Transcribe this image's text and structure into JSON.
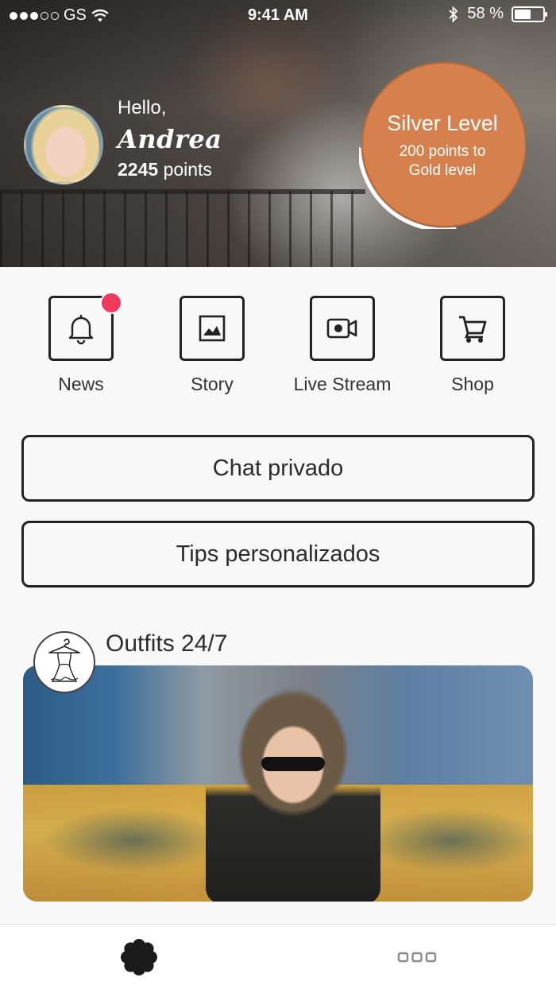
{
  "status_bar": {
    "carrier": "GS",
    "signal_dots_filled": 3,
    "signal_dots_total": 5,
    "time": "9:41 AM",
    "battery_percent": "58 %",
    "battery_level": 0.58,
    "icons": [
      "wifi-icon",
      "bluetooth-icon",
      "battery-icon"
    ]
  },
  "profile": {
    "greeting": "Hello,",
    "name": "Andrea",
    "points_value": "2245",
    "points_unit": "points"
  },
  "level": {
    "title": "Silver Level",
    "subtitle": "200 points to Gold level",
    "accent_color": "#d5804d",
    "progress": 0.35
  },
  "quick_actions": [
    {
      "label": "News",
      "icon": "bell-icon",
      "has_badge": true
    },
    {
      "label": "Story",
      "icon": "image-icon",
      "has_badge": false
    },
    {
      "label": "Live Stream",
      "icon": "video-camera-icon",
      "has_badge": false
    },
    {
      "label": "Shop",
      "icon": "shopping-cart-icon",
      "has_badge": false
    }
  ],
  "badge_color": "#ef3a5d",
  "buttons": {
    "chat": "Chat privado",
    "tips": "Tips personalizados"
  },
  "outfits": {
    "title": "Outfits 24/7",
    "icon": "dress-hanger-icon"
  },
  "tab_bar": {
    "tabs": [
      {
        "icon": "asterisk-flower-icon",
        "active": true
      },
      {
        "icon": "more-icon",
        "active": false
      }
    ]
  }
}
